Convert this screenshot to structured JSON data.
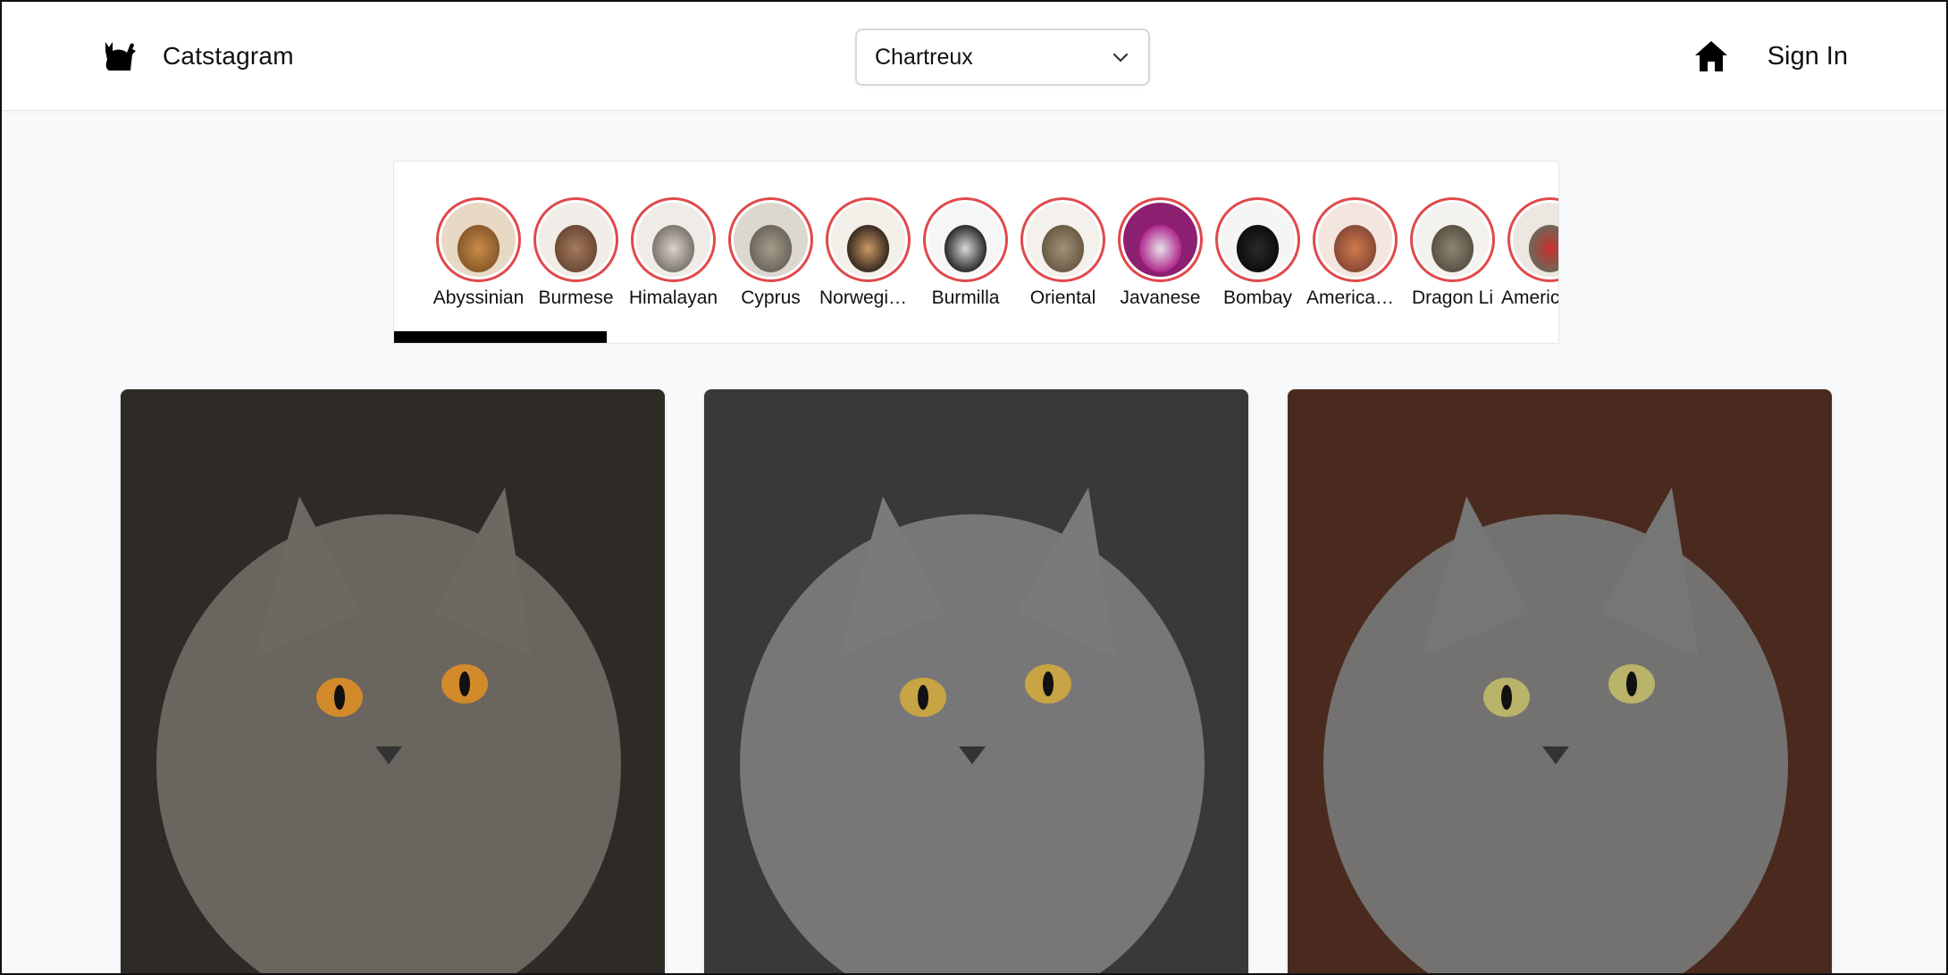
{
  "header": {
    "brand_name": "Catstagram",
    "logo_icon": "cat-silhouette-icon",
    "breed_select": {
      "value": "Chartreux",
      "icon": "chevron-down-icon"
    },
    "home_icon": "home-icon",
    "sign_in_label": "Sign In"
  },
  "breeds": [
    {
      "label": "Abyssinian",
      "colors": [
        "#8a5a2a",
        "#c98c4a",
        "#e8d9c4"
      ]
    },
    {
      "label": "Burmese",
      "colors": [
        "#6b4a35",
        "#a67b5e",
        "#f1ede8"
      ]
    },
    {
      "label": "Himalayan",
      "colors": [
        "#7d7770",
        "#d9d3ca",
        "#efece7"
      ]
    },
    {
      "label": "Cyprus",
      "colors": [
        "#6e675c",
        "#a69c8c",
        "#dcd8d0"
      ]
    },
    {
      "label": "Norwegian Forest",
      "colors": [
        "#3a2a22",
        "#c99a63",
        "#f3efe9"
      ]
    },
    {
      "label": "Burmilla",
      "colors": [
        "#2b2b2b",
        "#d9d9d9",
        "#f6f6f6"
      ]
    },
    {
      "label": "Oriental",
      "colors": [
        "#6b5b45",
        "#a3927a",
        "#f4f1ec"
      ]
    },
    {
      "label": "Javanese",
      "colors": [
        "#b02a8e",
        "#e7e3ea",
        "#8d1f70"
      ]
    },
    {
      "label": "Bombay",
      "colors": [
        "#0d0d0d",
        "#2a2a2a",
        "#f5f5f5"
      ]
    },
    {
      "label": "American Bobtail",
      "colors": [
        "#8a4a36",
        "#d07a4e",
        "#f2e6df"
      ]
    },
    {
      "label": "Dragon Li",
      "colors": [
        "#5a5345",
        "#8e8573",
        "#f4f2ee"
      ]
    },
    {
      "label": "American Curl",
      "colors": [
        "#6d6758",
        "#c9302c",
        "#ece7e0"
      ]
    }
  ],
  "photos": [
    {
      "name": "chartreux-photo-1",
      "colors": [
        "#2e2a26",
        "#6e6862",
        "#d28a2a"
      ]
    },
    {
      "name": "chartreux-photo-2",
      "colors": [
        "#3a3838",
        "#7a7a7c",
        "#c9a445"
      ]
    },
    {
      "name": "chartreux-photo-3",
      "colors": [
        "#4a2a1e",
        "#767676",
        "#b9b46a"
      ]
    }
  ],
  "accent_ring_color": "#e0494b"
}
